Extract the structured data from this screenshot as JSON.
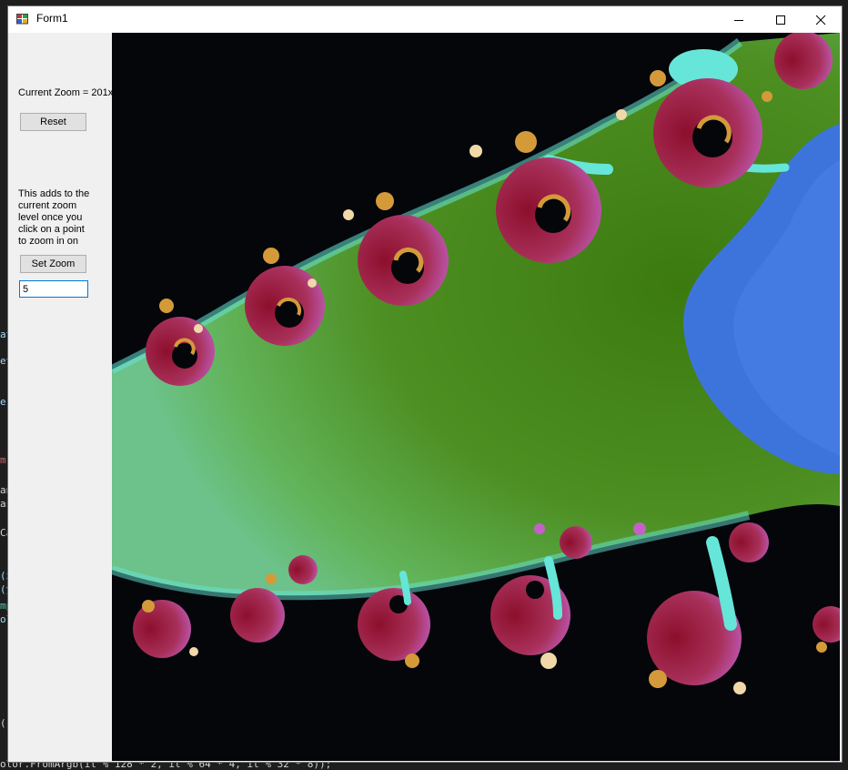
{
  "window": {
    "title": "Form1"
  },
  "left_panel": {
    "zoom_label": "Current Zoom = 201x",
    "reset_label": "Reset",
    "help_text": "This adds to the current zoom level once you click on a point to zoom in on",
    "set_zoom_label": "Set Zoom",
    "zoom_input_value": "5"
  },
  "background_code": {
    "fragments": [
      {
        "text": "at",
        "color": "#9cdcfe"
      },
      {
        "text": "et",
        "color": "#9cdcfe"
      },
      {
        "text": "er",
        "color": "#9cdcfe"
      },
      {
        "text": "m",
        "color": "#d16969"
      },
      {
        "text": "an",
        "color": "#d4d4d4"
      },
      {
        "text": "as",
        "color": "#d4d4d4"
      },
      {
        "text": "Ca",
        "color": "#d4d4d4"
      },
      {
        "text": "(x",
        "color": "#9cdcfe"
      },
      {
        "text": "(y",
        "color": "#9cdcfe"
      },
      {
        "text": "mp",
        "color": "#4ec9b0"
      },
      {
        "text": "ol",
        "color": "#9cdcfe"
      },
      {
        "text": "()",
        "color": "#d4d4d4"
      },
      {
        "text": "olor.FromArgb(it % 128 * 2, it % 64 * 4, it % 32 * 8));",
        "color": "#d4d4d4"
      }
    ]
  },
  "fractal": {
    "colors": {
      "interior": "#04060a",
      "green_dark": "#3c7a10",
      "green_light": "#6cc28a",
      "teal": "#66e6d8",
      "blue": "#3d74dc",
      "maroon": "#8c0f2c",
      "magenta": "#c262c8",
      "gold": "#d49a3a",
      "cream": "#f0d8a8"
    }
  }
}
